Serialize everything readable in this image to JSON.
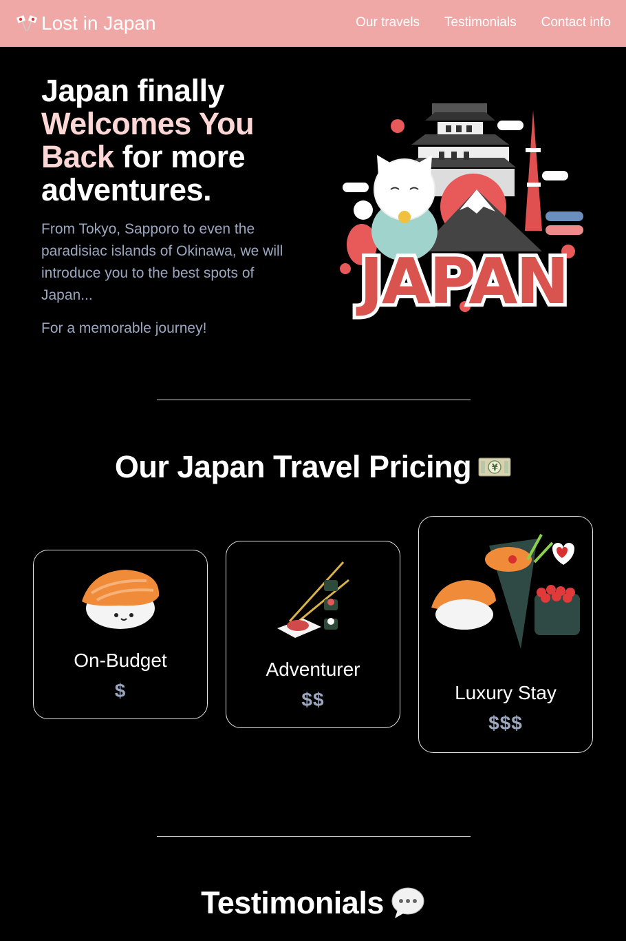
{
  "nav": {
    "brand": "Lost in Japan",
    "links": [
      "Our travels",
      "Testimonials",
      "Contact info"
    ]
  },
  "hero": {
    "title_part1": "Japan finally ",
    "title_accent": "Welcomes You Back",
    "title_part2": " for more adventures.",
    "description": "From Tokyo, Sapporo to even the paradisiac islands of Okinawa, we will introduce you to the best spots of Japan...",
    "tagline": "For a memorable journey!",
    "illustration_text": "JAPAN"
  },
  "pricing": {
    "title": "Our Japan Travel Pricing",
    "title_icon": "yen-banknote-icon",
    "cards": [
      {
        "name": "On-Budget",
        "price": "$"
      },
      {
        "name": "Adventurer",
        "price": "$$"
      },
      {
        "name": "Luxury Stay",
        "price": "$$$"
      }
    ]
  },
  "testimonials": {
    "title": "Testimonials",
    "title_icon": "speech-bubble-icon"
  },
  "colors": {
    "nav_bg": "#f0a8a7",
    "accent": "#fcd7d6",
    "muted_text": "#9ca7bf",
    "background": "#000000"
  }
}
